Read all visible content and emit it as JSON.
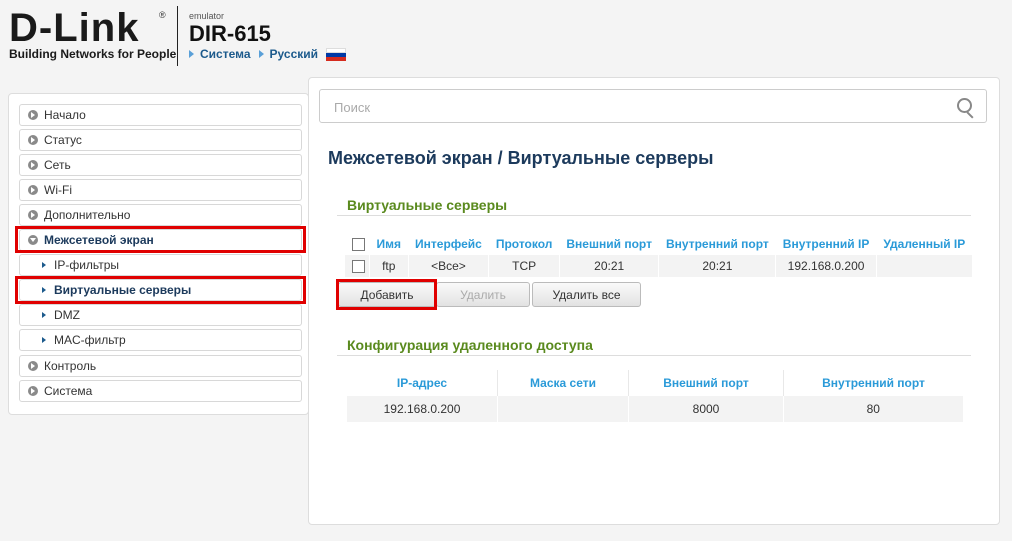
{
  "header": {
    "logo": "D-Link",
    "logo_reg": "®",
    "tagline": "Building Networks for People",
    "emulator": "emulator",
    "model": "DIR-615",
    "crumb_system": "Система",
    "crumb_lang": "Русский"
  },
  "sidebar": {
    "items": [
      {
        "label": "Начало"
      },
      {
        "label": "Статус"
      },
      {
        "label": "Сеть"
      },
      {
        "label": "Wi-Fi"
      },
      {
        "label": "Дополнительно"
      },
      {
        "label": "Межсетевой экран"
      },
      {
        "label": "IP-фильтры"
      },
      {
        "label": "Виртуальные серверы"
      },
      {
        "label": "DMZ"
      },
      {
        "label": "MAC-фильтр"
      },
      {
        "label": "Контроль"
      },
      {
        "label": "Система"
      }
    ]
  },
  "search": {
    "placeholder": "Поиск"
  },
  "main": {
    "title": "Межсетевой экран /  Виртуальные серверы",
    "vs_section": "Виртуальные серверы",
    "vs_headers": [
      "Имя",
      "Интерфейс",
      "Протокол",
      "Внешний порт",
      "Внутренний порт",
      "Внутренний IP",
      "Удаленный IP"
    ],
    "vs_row": [
      "ftp",
      "<Все>",
      "TCP",
      "20:21",
      "20:21",
      "192.168.0.200",
      ""
    ],
    "buttons": {
      "add": "Добавить",
      "delete": "Удалить",
      "delete_all": "Удалить все"
    },
    "rc_section": "Конфигурация удаленного доступа",
    "rc_headers": [
      "IP-адрес",
      "Маска сети",
      "Внешний порт",
      "Внутренний порт"
    ],
    "rc_row": [
      "192.168.0.200",
      "",
      "8000",
      "80"
    ]
  },
  "colors": {
    "highlight": "#e00000",
    "section_green": "#5a8a1e",
    "header_blue": "#2a9ad8"
  }
}
